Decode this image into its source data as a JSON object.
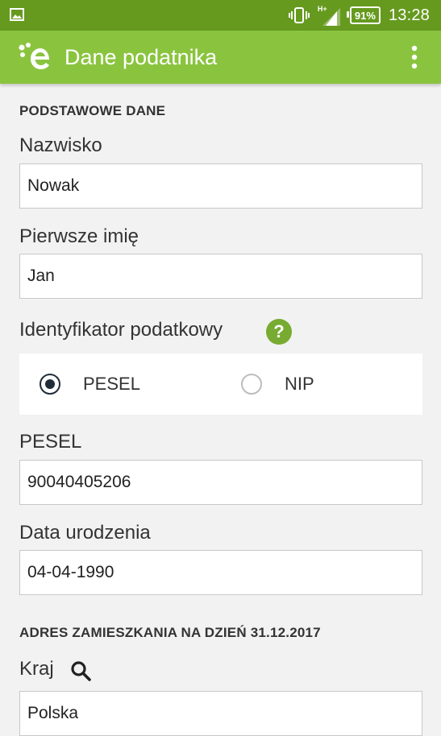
{
  "status_bar": {
    "network": "H+",
    "battery": "91%",
    "time": "13:28",
    "color": "#669a1f"
  },
  "app_bar": {
    "title": "Dane podatnika",
    "color": "#8ac43f",
    "logo_icon": "e-logo-icon",
    "menu_icon": "more-vert-icon"
  },
  "form": {
    "basic_section": {
      "header": "PODSTAWOWE DANE"
    },
    "surname": {
      "label": "Nazwisko",
      "value": "Nowak"
    },
    "first_name": {
      "label": "Pierwsze imię",
      "value": "Jan"
    },
    "tax_id": {
      "label": "Identyfikator podatkowy",
      "help": "?",
      "options": [
        {
          "label": "PESEL",
          "selected": true
        },
        {
          "label": "NIP",
          "selected": false
        }
      ]
    },
    "pesel": {
      "label": "PESEL",
      "value": "90040405206"
    },
    "birth_date": {
      "label": "Data urodzenia",
      "value": "04-04-1990"
    },
    "address_section": {
      "header": "ADRES ZAMIESZKANIA NA DZIEŃ 31.12.2017"
    },
    "country": {
      "label": "Kraj",
      "value": "Polska",
      "icon": "search-icon"
    }
  },
  "colors": {
    "accent": "#8ac43f",
    "help_icon": "#77ab32",
    "radio_selected": "#202c3a"
  }
}
